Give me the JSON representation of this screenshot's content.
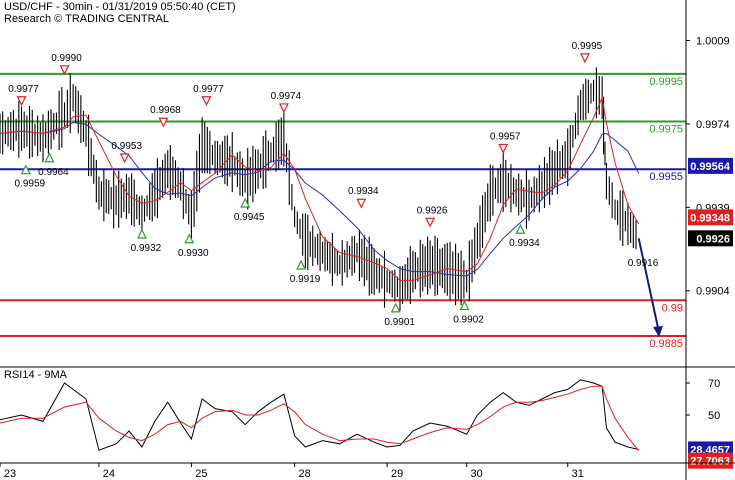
{
  "header": {
    "title": "USD/CHF - 30min - 01/31/2019 05:50:40 (CET)",
    "research": "Research © TRADING CENTRAL"
  },
  "colors": {
    "price": "#000000",
    "ma_fast": "#e02020",
    "ma_slow": "#2030c0",
    "resistance": "#2e9a2e",
    "pivot": "#1a1aa6",
    "support": "#e02020",
    "arrow": "#0d1f7a",
    "up_marker": "#2e9a2e",
    "down_marker": "#e02020"
  },
  "chart_data": [
    {
      "type": "line",
      "title": "USD/CHF - 30min - 01/31/2019 05:50:40 (CET)",
      "x_labels": [
        "23",
        "24",
        "25",
        "28",
        "29",
        "30",
        "31"
      ],
      "y_ticks": [
        1.0009,
        0.9974,
        0.9939,
        0.9904
      ],
      "ylim": [
        0.9872,
        1.0026
      ],
      "current_price": "0.9926",
      "levels": [
        {
          "label": "0.9995",
          "value": 0.9995,
          "role": "resistance"
        },
        {
          "label": "0.9975",
          "value": 0.9975,
          "role": "resistance"
        },
        {
          "label": "0.9955",
          "value": 0.9955,
          "role": "pivot"
        },
        {
          "label": "0.99",
          "value": 0.99,
          "role": "support"
        },
        {
          "label": "0.9885",
          "value": 0.9885,
          "role": "support"
        }
      ],
      "price_tags": [
        {
          "label": "0.99564",
          "value": 0.99564,
          "color": "#1a1aa6"
        },
        {
          "label": "0.99348",
          "value": 0.99348,
          "color": "#e02020"
        },
        {
          "label": "0.9926",
          "value": 0.9926,
          "color": "#000000"
        }
      ],
      "annotations": [
        {
          "text": "0.9977",
          "x": 0.5,
          "price": 0.9977,
          "kind": "high"
        },
        {
          "text": "0.9959",
          "x": 0.6,
          "price": 0.9959,
          "kind": "low"
        },
        {
          "text": "0.9990",
          "x": 1.5,
          "price": 0.999,
          "kind": "high"
        },
        {
          "text": "0.9964",
          "x": 1.15,
          "price": 0.9964,
          "kind": "low"
        },
        {
          "text": "0.9953",
          "x": 2.9,
          "price": 0.9953,
          "kind": "high"
        },
        {
          "text": "0.9968",
          "x": 3.8,
          "price": 0.9968,
          "kind": "high"
        },
        {
          "text": "0.9932",
          "x": 3.3,
          "price": 0.9932,
          "kind": "low"
        },
        {
          "text": "0.9930",
          "x": 4.4,
          "price": 0.993,
          "kind": "low"
        },
        {
          "text": "0.9977",
          "x": 4.8,
          "price": 0.9977,
          "kind": "high"
        },
        {
          "text": "0.9945",
          "x": 5.7,
          "price": 0.9945,
          "kind": "low"
        },
        {
          "text": "0.9974",
          "x": 6.6,
          "price": 0.9974,
          "kind": "high"
        },
        {
          "text": "0.9919",
          "x": 7.0,
          "price": 0.9919,
          "kind": "low"
        },
        {
          "text": "0.9934",
          "x": 8.4,
          "price": 0.9934,
          "kind": "high"
        },
        {
          "text": "0.9901",
          "x": 9.2,
          "price": 0.9901,
          "kind": "low"
        },
        {
          "text": "0.9926",
          "x": 10.0,
          "price": 0.9926,
          "kind": "high"
        },
        {
          "text": "0.9902",
          "x": 10.8,
          "price": 0.9902,
          "kind": "low"
        },
        {
          "text": "0.9957",
          "x": 11.7,
          "price": 0.9957,
          "kind": "high"
        },
        {
          "text": "0.9934",
          "x": 12.1,
          "price": 0.9934,
          "kind": "low"
        },
        {
          "text": "0.9995",
          "x": 13.6,
          "price": 0.9995,
          "kind": "high"
        },
        {
          "text": "0.9916",
          "x": 14.95,
          "price": 0.9916,
          "kind": "target"
        }
      ],
      "price_path": [
        [
          0,
          0.997
        ],
        [
          0.5,
          0.9972
        ],
        [
          1.0,
          0.9968
        ],
        [
          1.5,
          0.9978
        ],
        [
          1.7,
          0.9985
        ],
        [
          2.0,
          0.997
        ],
        [
          2.3,
          0.9945
        ],
        [
          2.7,
          0.9942
        ],
        [
          3.0,
          0.9944
        ],
        [
          3.3,
          0.9936
        ],
        [
          3.6,
          0.9945
        ],
        [
          3.9,
          0.9955
        ],
        [
          4.2,
          0.9948
        ],
        [
          4.45,
          0.9935
        ],
        [
          4.7,
          0.9965
        ],
        [
          5.0,
          0.996
        ],
        [
          5.4,
          0.9958
        ],
        [
          5.7,
          0.995
        ],
        [
          6.0,
          0.9955
        ],
        [
          6.3,
          0.9962
        ],
        [
          6.6,
          0.9968
        ],
        [
          6.85,
          0.9935
        ],
        [
          7.1,
          0.9925
        ],
        [
          7.5,
          0.992
        ],
        [
          7.9,
          0.9915
        ],
        [
          8.3,
          0.992
        ],
        [
          8.7,
          0.9912
        ],
        [
          9.0,
          0.9908
        ],
        [
          9.3,
          0.9905
        ],
        [
          9.6,
          0.9912
        ],
        [
          10.0,
          0.9915
        ],
        [
          10.4,
          0.9913
        ],
        [
          10.85,
          0.9908
        ],
        [
          11.1,
          0.9925
        ],
        [
          11.4,
          0.9945
        ],
        [
          11.7,
          0.995
        ],
        [
          12.0,
          0.9945
        ],
        [
          12.3,
          0.9942
        ],
        [
          12.6,
          0.9948
        ],
        [
          12.9,
          0.9955
        ],
        [
          13.2,
          0.996
        ],
        [
          13.5,
          0.9982
        ],
        [
          13.8,
          0.9988
        ],
        [
          14.0,
          0.9985
        ],
        [
          14.1,
          0.995
        ],
        [
          14.3,
          0.9938
        ],
        [
          14.6,
          0.9932
        ],
        [
          14.85,
          0.9926
        ]
      ],
      "forecast": [
        [
          14.85,
          0.9926
        ],
        [
          15.3,
          0.9885
        ]
      ]
    },
    {
      "type": "line",
      "title": "RSI14 - 9MA",
      "y_ticks": [
        70,
        50
      ],
      "ylim": [
        20,
        80
      ],
      "rsi_value": "28.4657",
      "ma_value": "27.7063",
      "series": [
        {
          "name": "RSI14",
          "values": [
            [
              0,
              47
            ],
            [
              0.5,
              50
            ],
            [
              1.0,
              46
            ],
            [
              1.5,
              70
            ],
            [
              2.0,
              60
            ],
            [
              2.3,
              28
            ],
            [
              2.7,
              32
            ],
            [
              3.0,
              40
            ],
            [
              3.3,
              30
            ],
            [
              3.6,
              46
            ],
            [
              3.9,
              58
            ],
            [
              4.2,
              45
            ],
            [
              4.45,
              35
            ],
            [
              4.7,
              60
            ],
            [
              5.0,
              54
            ],
            [
              5.4,
              52
            ],
            [
              5.7,
              44
            ],
            [
              6.0,
              52
            ],
            [
              6.3,
              58
            ],
            [
              6.6,
              63
            ],
            [
              6.85,
              37
            ],
            [
              7.1,
              30
            ],
            [
              7.5,
              34
            ],
            [
              7.9,
              32
            ],
            [
              8.3,
              38
            ],
            [
              8.7,
              33
            ],
            [
              9.0,
              30
            ],
            [
              9.3,
              31
            ],
            [
              9.6,
              40
            ],
            [
              10.0,
              45
            ],
            [
              10.4,
              43
            ],
            [
              10.85,
              38
            ],
            [
              11.1,
              50
            ],
            [
              11.4,
              58
            ],
            [
              11.7,
              64
            ],
            [
              12.0,
              58
            ],
            [
              12.3,
              56
            ],
            [
              12.6,
              60
            ],
            [
              12.9,
              64
            ],
            [
              13.2,
              66
            ],
            [
              13.5,
              72
            ],
            [
              13.8,
              70
            ],
            [
              14.0,
              68
            ],
            [
              14.1,
              42
            ],
            [
              14.3,
              33
            ],
            [
              14.6,
              30
            ],
            [
              14.85,
              28.4657
            ]
          ]
        },
        {
          "name": "9MA",
          "values": [
            [
              0,
              45
            ],
            [
              0.5,
              48
            ],
            [
              1.0,
              48
            ],
            [
              1.5,
              55
            ],
            [
              2.0,
              58
            ],
            [
              2.3,
              48
            ],
            [
              2.7,
              40
            ],
            [
              3.0,
              36
            ],
            [
              3.3,
              34
            ],
            [
              3.6,
              38
            ],
            [
              3.9,
              44
            ],
            [
              4.2,
              46
            ],
            [
              4.45,
              42
            ],
            [
              4.7,
              48
            ],
            [
              5.0,
              52
            ],
            [
              5.4,
              53
            ],
            [
              5.7,
              50
            ],
            [
              6.0,
              50
            ],
            [
              6.3,
              53
            ],
            [
              6.6,
              57
            ],
            [
              6.85,
              52
            ],
            [
              7.1,
              44
            ],
            [
              7.5,
              38
            ],
            [
              7.9,
              34
            ],
            [
              8.3,
              35
            ],
            [
              8.7,
              35
            ],
            [
              9.0,
              33
            ],
            [
              9.3,
              32
            ],
            [
              9.6,
              35
            ],
            [
              10.0,
              39
            ],
            [
              10.4,
              42
            ],
            [
              10.85,
              41
            ],
            [
              11.1,
              44
            ],
            [
              11.4,
              49
            ],
            [
              11.7,
              55
            ],
            [
              12.0,
              58
            ],
            [
              12.3,
              58
            ],
            [
              12.6,
              59
            ],
            [
              12.9,
              61
            ],
            [
              13.2,
              63
            ],
            [
              13.5,
              66
            ],
            [
              13.8,
              68
            ],
            [
              14.0,
              68
            ],
            [
              14.1,
              60
            ],
            [
              14.3,
              48
            ],
            [
              14.6,
              36
            ],
            [
              14.85,
              27.7063
            ]
          ]
        }
      ]
    }
  ]
}
